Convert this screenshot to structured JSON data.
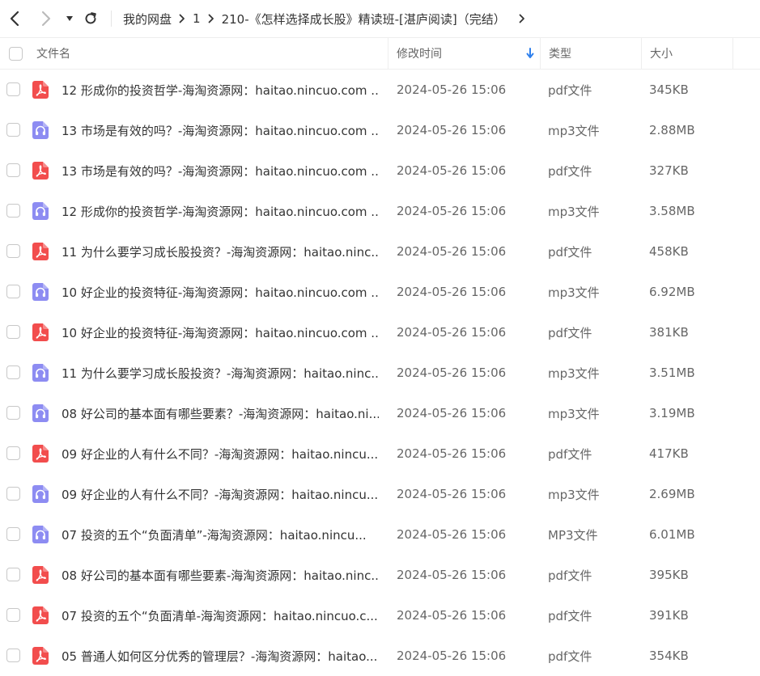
{
  "nav": {
    "back_icon": "chevron-left-icon",
    "forward_icon": "chevron-right-icon",
    "dropdown_icon": "triangle-down-icon",
    "refresh_icon": "refresh-icon"
  },
  "breadcrumb": [
    "我的网盘",
    "1",
    "210-《怎样选择成长股》精读班-[湛庐阅读]（完结）"
  ],
  "columns": {
    "name": "文件名",
    "modified": "修改时间",
    "type": "类型",
    "size": "大小"
  },
  "colors": {
    "pdf_icon": "#f24d4d",
    "audio_icon": "#8d8cf2",
    "sort_arrow": "#2f80ed"
  },
  "files": [
    {
      "kind": "pdf",
      "name": "12 形成你的投资哲学-海淘资源网：haitao.nincuo.com ...",
      "modified": "2024-05-26 15:06",
      "type": "pdf文件",
      "size": "345KB"
    },
    {
      "kind": "audio",
      "name": "13 市场是有效的吗？-海淘资源网：haitao.nincuo.com ...",
      "modified": "2024-05-26 15:06",
      "type": "mp3文件",
      "size": "2.88MB"
    },
    {
      "kind": "pdf",
      "name": "13 市场是有效的吗？-海淘资源网：haitao.nincuo.com ...",
      "modified": "2024-05-26 15:06",
      "type": "pdf文件",
      "size": "327KB"
    },
    {
      "kind": "audio",
      "name": "12 形成你的投资哲学-海淘资源网：haitao.nincuo.com ...",
      "modified": "2024-05-26 15:06",
      "type": "mp3文件",
      "size": "3.58MB"
    },
    {
      "kind": "pdf",
      "name": "11 为什么要学习成长股投资？-海淘资源网：haitao.ninc...",
      "modified": "2024-05-26 15:06",
      "type": "pdf文件",
      "size": "458KB"
    },
    {
      "kind": "audio",
      "name": "10 好企业的投资特征-海淘资源网：haitao.nincuo.com ...",
      "modified": "2024-05-26 15:06",
      "type": "mp3文件",
      "size": "6.92MB"
    },
    {
      "kind": "pdf",
      "name": "10 好企业的投资特征-海淘资源网：haitao.nincuo.com ...",
      "modified": "2024-05-26 15:06",
      "type": "pdf文件",
      "size": "381KB"
    },
    {
      "kind": "audio",
      "name": "11 为什么要学习成长股投资？-海淘资源网：haitao.ninc...",
      "modified": "2024-05-26 15:06",
      "type": "mp3文件",
      "size": "3.51MB"
    },
    {
      "kind": "audio",
      "name": "08 好公司的基本面有哪些要素？-海淘资源网：haitao.ni...",
      "modified": "2024-05-26 15:06",
      "type": "mp3文件",
      "size": "3.19MB"
    },
    {
      "kind": "pdf",
      "name": "09 好企业的人有什么不同？-海淘资源网：haitao.nincu...",
      "modified": "2024-05-26 15:06",
      "type": "pdf文件",
      "size": "417KB"
    },
    {
      "kind": "audio",
      "name": "09 好企业的人有什么不同？-海淘资源网：haitao.nincu...",
      "modified": "2024-05-26 15:06",
      "type": "mp3文件",
      "size": "2.69MB"
    },
    {
      "kind": "audio",
      "name": "07 投资的五个“负面清单”-海淘资源网：haitao.nincu...",
      "modified": "2024-05-26 15:06",
      "type": "MP3文件",
      "size": "6.01MB"
    },
    {
      "kind": "pdf",
      "name": "08 好公司的基本面有哪些要素-海淘资源网：haitao.ninc...",
      "modified": "2024-05-26 15:06",
      "type": "pdf文件",
      "size": "395KB"
    },
    {
      "kind": "pdf",
      "name": "07 投资的五个“负面清单-海淘资源网：haitao.nincuo.c...",
      "modified": "2024-05-26 15:06",
      "type": "pdf文件",
      "size": "391KB"
    },
    {
      "kind": "pdf",
      "name": "05 普通人如何区分优秀的管理层？-海淘资源网：haitao...",
      "modified": "2024-05-26 15:06",
      "type": "pdf文件",
      "size": "354KB"
    }
  ]
}
